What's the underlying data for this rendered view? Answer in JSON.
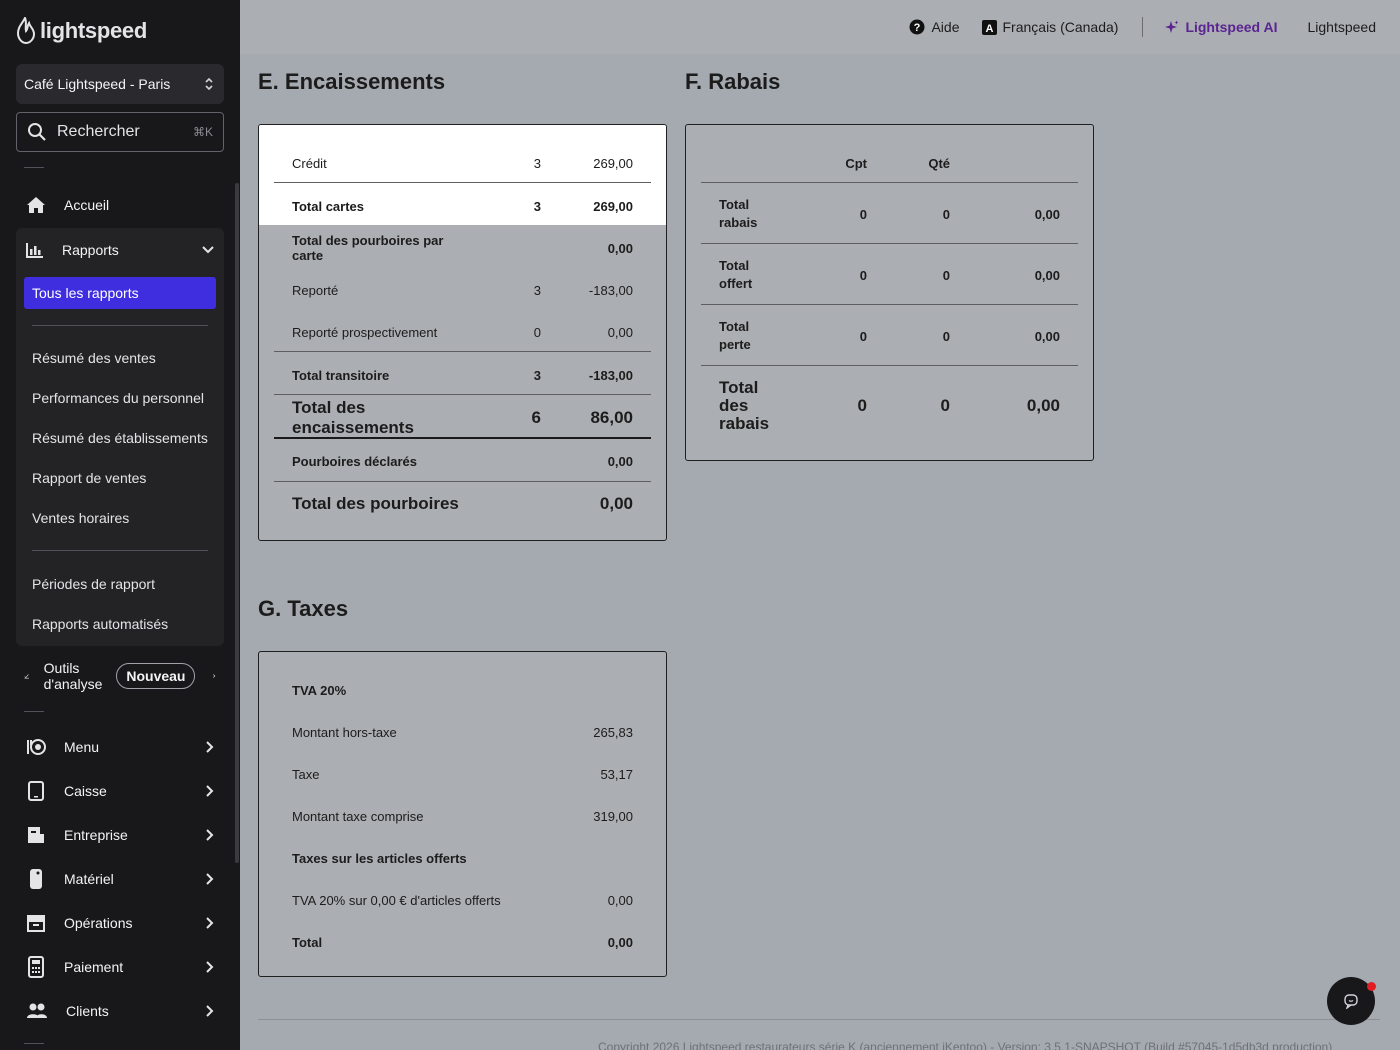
{
  "sidebar": {
    "logo": "lightspeed",
    "store": "Café Lightspeed - Paris",
    "search": {
      "label": "Rechercher",
      "shortcut": "⌘K"
    },
    "home": "Accueil",
    "reports": {
      "label": "Rapports",
      "active": "Tous les rapports",
      "group1": [
        "Résumé des ventes",
        "Performances du personnel",
        "Résumé des établissements",
        "Rapport de ventes",
        "Ventes horaires"
      ],
      "group2": [
        "Périodes de rapport",
        "Rapports automatisés"
      ]
    },
    "analytics": {
      "label_line1": "Outils",
      "label_line2": "d'analyse",
      "badge": "Nouveau"
    },
    "items": [
      "Menu",
      "Caisse",
      "Entreprise",
      "Matériel",
      "Opérations",
      "Paiement",
      "Clients"
    ]
  },
  "topbar": {
    "help": "Aide",
    "language": "Français (Canada)",
    "ai": "Lightspeed AI",
    "account": "Lightspeed"
  },
  "encaissements": {
    "title": "E. Encaissements",
    "rows": [
      {
        "label": "Crédit",
        "count": "3",
        "amount": "269,00"
      },
      {
        "label": "Total cartes",
        "count": "3",
        "amount": "269,00"
      },
      {
        "label": "Total des pourboires par carte",
        "count": "",
        "amount": "0,00"
      },
      {
        "label": "Reporté",
        "count": "3",
        "amount": "-183,00"
      },
      {
        "label": "Reporté prospectivement",
        "count": "0",
        "amount": "0,00"
      },
      {
        "label": "Total transitoire",
        "count": "3",
        "amount": "-183,00"
      },
      {
        "label": "Total des encaissements",
        "count": "6",
        "amount": "86,00"
      },
      {
        "label": "Pourboires déclarés",
        "count": "",
        "amount": "0,00"
      },
      {
        "label": "Total des pourboires",
        "count": "",
        "amount": "0,00"
      }
    ]
  },
  "rabais": {
    "title": "F. Rabais",
    "headers": {
      "count": "Cpt",
      "qty": "Qté"
    },
    "rows": [
      {
        "label1": "Total",
        "label2": "rabais",
        "label3": "",
        "count": "0",
        "qty": "0",
        "amount": "0,00"
      },
      {
        "label1": "Total",
        "label2": "offert",
        "label3": "",
        "count": "0",
        "qty": "0",
        "amount": "0,00"
      },
      {
        "label1": "Total",
        "label2": "perte",
        "label3": "",
        "count": "0",
        "qty": "0",
        "amount": "0,00"
      },
      {
        "label1": "Total",
        "label2": "des",
        "label3": "rabais",
        "count": "0",
        "qty": "0",
        "amount": "0,00"
      }
    ]
  },
  "taxes": {
    "title": "G. Taxes",
    "rows": [
      {
        "label": "TVA 20%",
        "amount": ""
      },
      {
        "label": "Montant hors-taxe",
        "amount": "265,83"
      },
      {
        "label": "Taxe",
        "amount": "53,17"
      },
      {
        "label": "Montant taxe comprise",
        "amount": "319,00"
      },
      {
        "label": "Taxes sur les articles offerts",
        "amount": ""
      },
      {
        "label": "TVA 20% sur 0,00 € d'articles offerts",
        "amount": "0,00"
      },
      {
        "label": "Total",
        "amount": "0,00"
      }
    ]
  },
  "footer": "Copyright 2026 Lightspeed restaurateurs série K (anciennement iKentoo) - Version: 3.5.1-SNAPSHOT (Build #57045-1d5db3d production)"
}
